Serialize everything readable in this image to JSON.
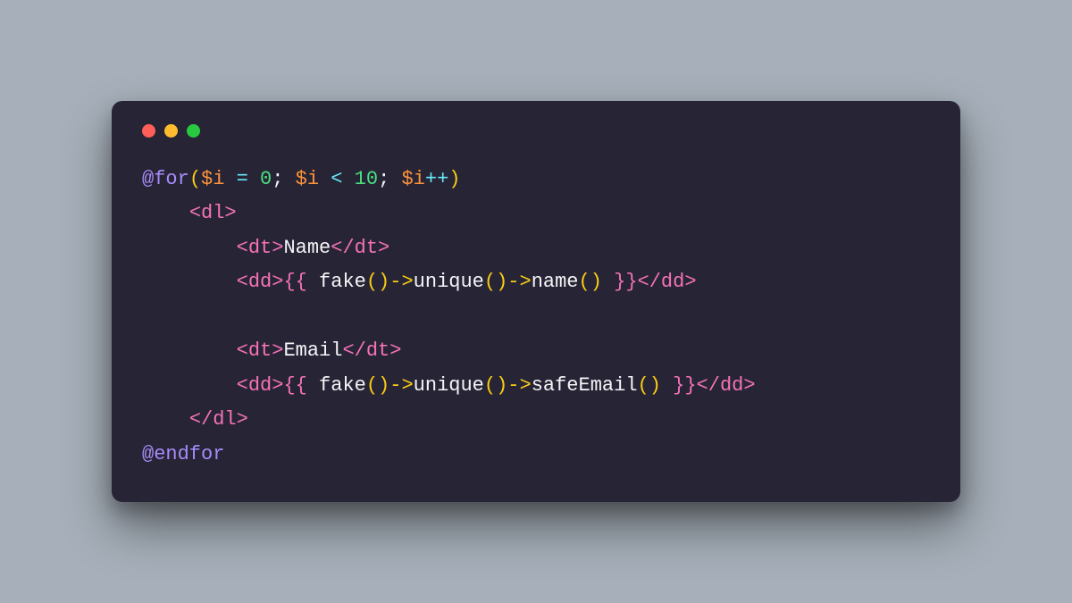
{
  "dots": {
    "red": "#ff5f57",
    "yellow": "#febc2e",
    "green": "#28c840"
  },
  "code": {
    "l1": {
      "at": "@",
      "for": "for",
      "op": "(",
      "v": "$i",
      "sp": " ",
      "eq": "=",
      "sp2": " ",
      "n0": "0",
      "semi": "; ",
      "v2": "$i",
      "sp3": " ",
      "lt": "<",
      "sp4": " ",
      "n10": "10",
      "semi2": "; ",
      "v3": "$i",
      "pp": "++",
      "cp": ")"
    },
    "l2": {
      "indent": "    ",
      "odl": "<dl>"
    },
    "l3": {
      "indent": "        ",
      "odt": "<dt>",
      "txt": "Name",
      "cdt": "</dt>"
    },
    "l4": {
      "indent": "        ",
      "odd": "<dd>",
      "ob": "{{ ",
      "f": "fake",
      "p1": "()",
      "a1": "->",
      "u": "unique",
      "p2": "()",
      "a2": "->",
      "n": "name",
      "p3": "() ",
      "cb": "}}",
      "cdd": "</dd>"
    },
    "l5": {
      "indent": ""
    },
    "l6": {
      "indent": "        ",
      "odt": "<dt>",
      "txt": "Email",
      "cdt": "</dt>"
    },
    "l7": {
      "indent": "        ",
      "odd": "<dd>",
      "ob": "{{ ",
      "f": "fake",
      "p1": "()",
      "a1": "->",
      "u": "unique",
      "p2": "()",
      "a2": "->",
      "n": "safeEmail",
      "p3": "() ",
      "cb": "}}",
      "cdd": "</dd>"
    },
    "l8": {
      "indent": "    ",
      "cdl": "</dl>"
    },
    "l9": {
      "end": "@endfor"
    }
  }
}
